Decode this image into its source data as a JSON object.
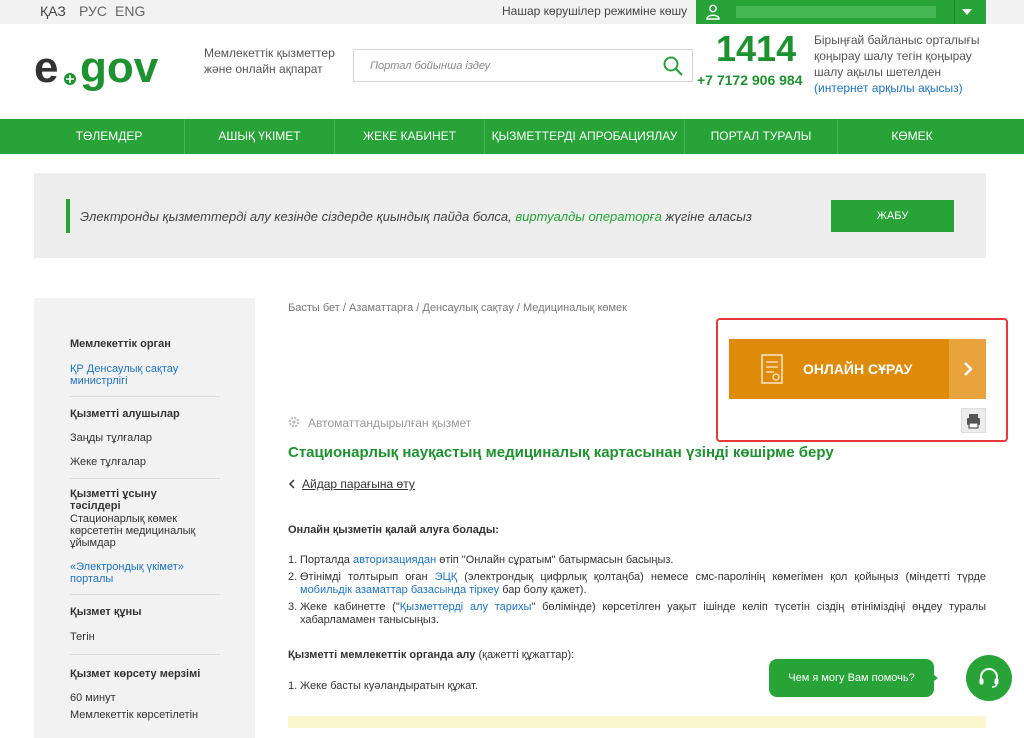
{
  "languages": [
    "ҚАЗ",
    "РУС",
    "ENG"
  ],
  "vision_mode_link": "Нашар көрушілер режиміне көшу",
  "header": {
    "logo_text": "e.gov",
    "tagline": "Мемлекеттік қызметтер және онлайн ақпарат",
    "search_placeholder": "Портал бойынша іздеу",
    "phone_short": "1414",
    "phone_long": "+7 7172 906 984",
    "phone_info_text": "Бірыңғай байланыс орталығы қоңырау шалу тегін қоңырау шалу ақылы шетелден ",
    "phone_info_link": "(интернет арқылы ақысыз)"
  },
  "nav": [
    "ТӨЛЕМДЕР",
    "АШЫҚ ҮКІМЕТ",
    "ЖЕКЕ КАБИНЕТ",
    "ҚЫЗМЕТТЕРДІ АПРОБАЦИЯЛАУ",
    "ПОРТАЛ ТУРАЛЫ",
    "КӨМЕК"
  ],
  "notice": {
    "text_before": "Электронды қызметтерді алу кезінде сіздерде қиындық пайда болса, ",
    "link": "виртуалды операторға",
    "text_after": " жүгіне аласыз",
    "close_label": "ЖАБУ"
  },
  "sidebar": {
    "gov_body_label": "Мемлекеттік орган",
    "gov_body_value": "ҚР Денсаулық сақтау министрлігі",
    "recipients_label": "Қызметті алушылар",
    "recipient_1": "Заңды тұлғалар",
    "recipient_2": "Жеке тұлғалар",
    "methods_label": "Қызметті ұсыну тәсілдері",
    "method_1": "Стационарлық көмек көрсететін медициналық ұйымдар",
    "method_2": "«Электрондық үкімет» порталы",
    "cost_label": "Қызмет құны",
    "cost_value": "Тегін",
    "term_label": "Қызмет көрсету мерзімі",
    "term_value_1": "60 минут",
    "term_value_2": "Мемлекеттік көрсетілетін"
  },
  "content": {
    "breadcrumb": "Басты бет / Азаматтарға / Денсаулық сақтау / Медициналық көмек",
    "online_request_label": "ОНЛАЙН СҰРАУ",
    "automated_label": "Автоматтандырылған қызмет",
    "title": "Стационарлық науқастың медициналық картасынан үзінді көшірме беру",
    "back_link": "Айдар парағына өту",
    "how_to_title": "Онлайн қызметін қалай алуға болады:",
    "step_1_pre": "Порталда ",
    "step_1_link": "авторизациядан",
    "step_1_post": " өтіп \"Онлайн сұратым\" батырмасын басыңыз.",
    "step_2_pre": "Өтінімді толтырып оған ",
    "step_2_link_1": "ЭЦҚ",
    "step_2_mid": " (электрондық цифрлық қолтаңба) немесе смс-паролінің көмегімен қол қойыңыз (міндетті түрде ",
    "step_2_link_2": "мобильдік азаматтар базасында тіркеу",
    "step_2_post": " бар болу қажет).",
    "step_3_pre": "Жеке кабинетте (\"",
    "step_3_link": "Қызметтерді алу тарихы",
    "step_3_post": "\" бөлімінде) көрсетілген уақыт ішінде келіп түсетін сіздің өтініміздіңі өңдеу туралы хабарламамен танысыңыз.",
    "bodies_bold": "Қызметті мемлекеттік органда алу",
    "bodies_rest": " (қажетті құжаттар):",
    "doc_1": "Жеке басты куәландыратын құжат."
  },
  "chat": {
    "bubble_text": "Чем я могу Вам помочь?"
  },
  "colors": {
    "brand_green": "#27a338",
    "accent_orange": "#df8b0a",
    "highlight_red": "#e8393a",
    "link_blue": "#1e73be"
  }
}
